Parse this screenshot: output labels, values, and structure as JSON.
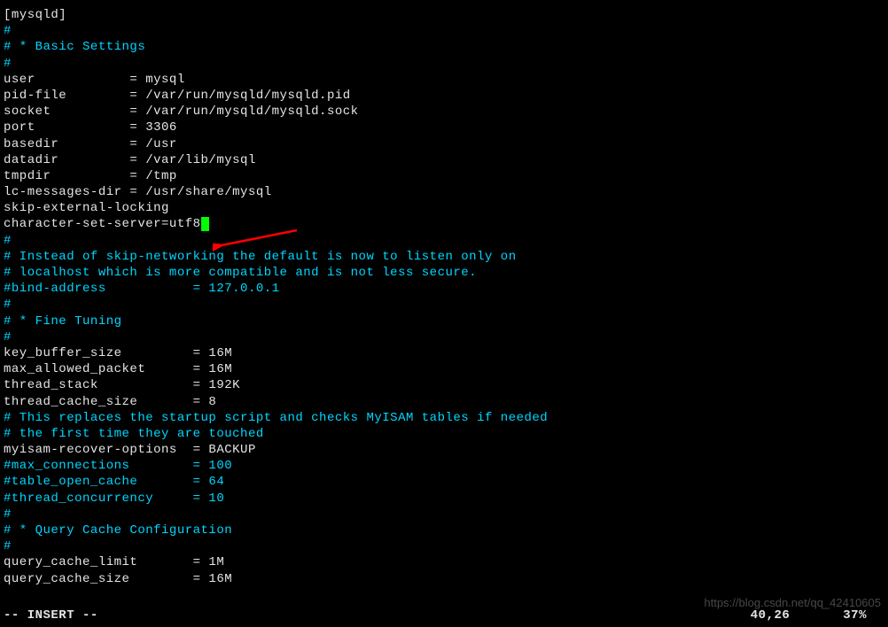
{
  "lines": [
    {
      "text": "[mysqld]",
      "class": "white"
    },
    {
      "text": "#",
      "class": "cyan"
    },
    {
      "text": "# * Basic Settings",
      "class": "cyan"
    },
    {
      "text": "#",
      "class": "cyan"
    },
    {
      "text": "user            = mysql",
      "class": "white"
    },
    {
      "text": "pid-file        = /var/run/mysqld/mysqld.pid",
      "class": "white"
    },
    {
      "text": "socket          = /var/run/mysqld/mysqld.sock",
      "class": "white"
    },
    {
      "text": "port            = 3306",
      "class": "white"
    },
    {
      "text": "basedir         = /usr",
      "class": "white"
    },
    {
      "text": "datadir         = /var/lib/mysql",
      "class": "white"
    },
    {
      "text": "tmpdir          = /tmp",
      "class": "white"
    },
    {
      "text": "lc-messages-dir = /usr/share/mysql",
      "class": "white"
    },
    {
      "text": "skip-external-locking",
      "class": "white"
    },
    {
      "text": "character-set-server=utf8",
      "class": "white",
      "cursor": true
    },
    {
      "text": "#",
      "class": "cyan"
    },
    {
      "text": "# Instead of skip-networking the default is now to listen only on",
      "class": "cyan"
    },
    {
      "text": "# localhost which is more compatible and is not less secure.",
      "class": "cyan"
    },
    {
      "text": "#bind-address           = 127.0.0.1",
      "class": "cyan"
    },
    {
      "text": "#",
      "class": "cyan"
    },
    {
      "text": "# * Fine Tuning",
      "class": "cyan"
    },
    {
      "text": "#",
      "class": "cyan"
    },
    {
      "text": "key_buffer_size         = 16M",
      "class": "white"
    },
    {
      "text": "max_allowed_packet      = 16M",
      "class": "white"
    },
    {
      "text": "thread_stack            = 192K",
      "class": "white"
    },
    {
      "text": "thread_cache_size       = 8",
      "class": "white"
    },
    {
      "text": "# This replaces the startup script and checks MyISAM tables if needed",
      "class": "cyan"
    },
    {
      "text": "# the first time they are touched",
      "class": "cyan"
    },
    {
      "text": "myisam-recover-options  = BACKUP",
      "class": "white"
    },
    {
      "text": "#max_connections        = 100",
      "class": "cyan"
    },
    {
      "text": "#table_open_cache       = 64",
      "class": "cyan"
    },
    {
      "text": "#thread_concurrency     = 10",
      "class": "cyan"
    },
    {
      "text": "#",
      "class": "cyan"
    },
    {
      "text": "# * Query Cache Configuration",
      "class": "cyan"
    },
    {
      "text": "#",
      "class": "cyan"
    },
    {
      "text": "query_cache_limit       = 1M",
      "class": "white"
    },
    {
      "text": "query_cache_size        = 16M",
      "class": "white"
    }
  ],
  "status": {
    "mode": "-- INSERT --",
    "position": "40,26",
    "percent": "37%"
  },
  "watermark": "https://blog.csdn.net/qq_42410605"
}
